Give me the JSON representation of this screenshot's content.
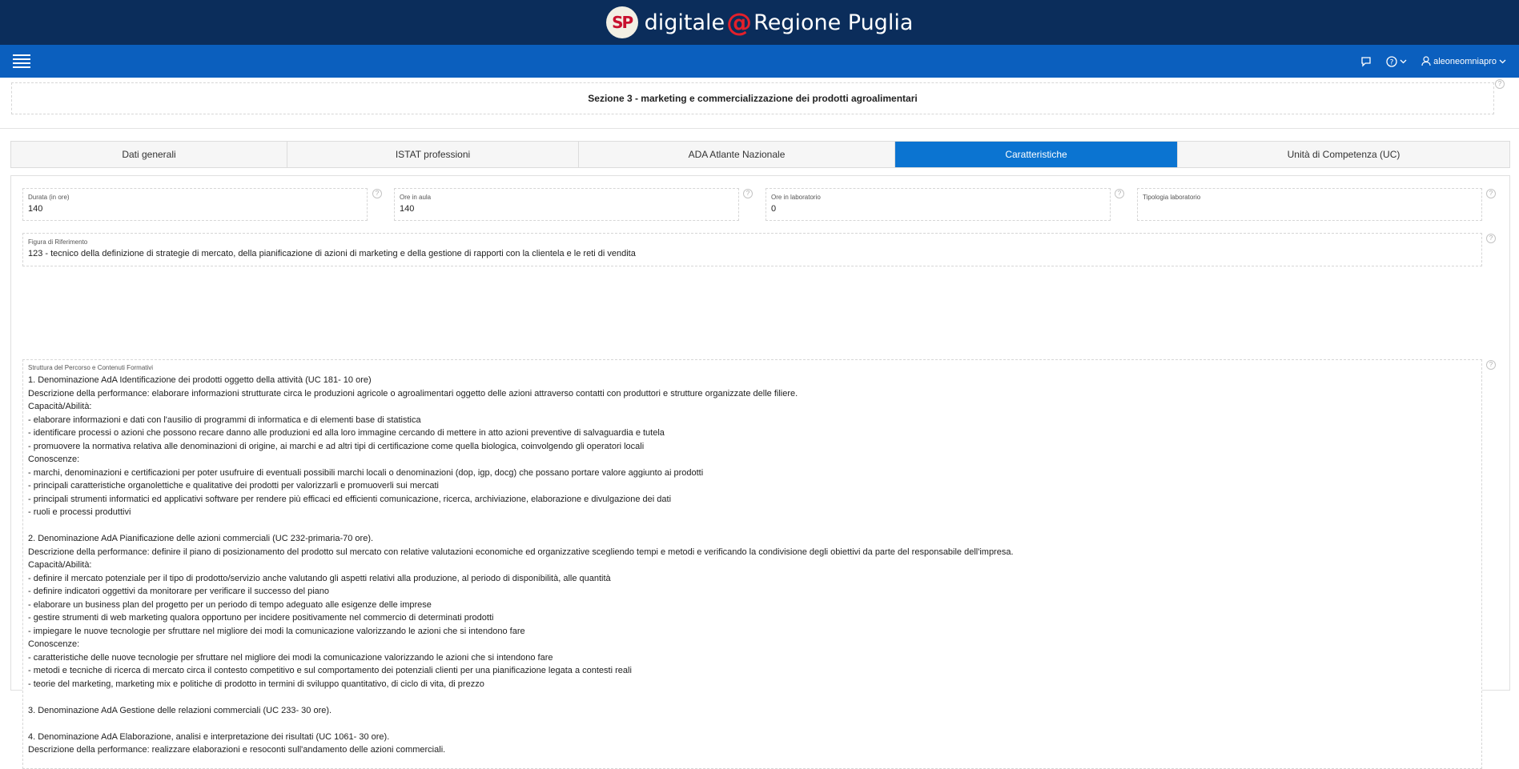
{
  "app": {
    "brand_prefix": "digitale",
    "brand_at": "@",
    "brand_suffix": "Regione Puglia",
    "logo_text": "SP"
  },
  "nav": {
    "user": "aleoneomniapro"
  },
  "section": {
    "title": "Sezione 3 - marketing e commercializzazione dei prodotti agroalimentari"
  },
  "tabs": [
    {
      "label": "Dati generali",
      "active": false
    },
    {
      "label": "ISTAT professioni",
      "active": false
    },
    {
      "label": "ADA Atlante Nazionale",
      "active": false
    },
    {
      "label": "Caratteristiche",
      "active": true
    },
    {
      "label": "Unità di Competenza (UC)",
      "active": false
    }
  ],
  "fields": {
    "durata": {
      "label": "Durata (in ore)",
      "value": "140"
    },
    "ore_aula": {
      "label": "Ore in aula",
      "value": "140"
    },
    "ore_laboratorio": {
      "label": "Ore in laboratorio",
      "value": "0"
    },
    "tipologia_laboratorio": {
      "label": "Tipologia laboratorio",
      "value": ""
    },
    "figura": {
      "label": "Figura di Riferimento",
      "value": "123 - tecnico della definizione di strategie di mercato, della pianificazione di azioni di marketing e della gestione di rapporti con la clientela e le reti di vendita"
    },
    "struttura": {
      "label": "Struttura del Percorso e Contenuti Formativi",
      "value": "1. Denominazione AdA Identificazione dei prodotti oggetto della attività (UC 181- 10 ore)\nDescrizione della performance: elaborare informazioni strutturate circa le produzioni agricole o agroalimentari oggetto delle azioni attraverso contatti con produttori e strutture organizzate delle filiere.\nCapacità/Abilità:\n- elaborare informazioni e dati con l'ausilio di programmi di informatica e di elementi base di statistica\n- identificare processi o azioni che possono recare danno alle produzioni ed alla loro immagine cercando di mettere in atto azioni preventive di salvaguardia e tutela\n- promuovere la normativa relativa alle denominazioni di origine, ai marchi e ad altri tipi di certificazione come quella biologica, coinvolgendo gli operatori locali\nConoscenze:\n- marchi, denominazioni e certificazioni per poter usufruire di eventuali possibili marchi locali o denominazioni (dop, igp, docg) che possano portare valore aggiunto ai prodotti\n- principali caratteristiche organolettiche e qualitative dei prodotti per valorizzarli e promuoverli sui mercati\n- principali strumenti informatici ed applicativi software per rendere più efficaci ed efficienti comunicazione, ricerca, archiviazione, elaborazione e divulgazione dei dati\n- ruoli e processi produttivi\n\n2. Denominazione AdA Pianificazione delle azioni commerciali (UC 232-primaria-70 ore).\nDescrizione della performance: definire il piano di posizionamento del prodotto sul mercato con relative valutazioni economiche ed organizzative scegliendo tempi e metodi e verificando la condivisione degli obiettivi da parte del responsabile dell'impresa.\nCapacità/Abilità:\n- definire il mercato potenziale per il tipo di prodotto/servizio anche valutando gli aspetti relativi alla produzione, al periodo di disponibilità, alle quantità\n- definire indicatori oggettivi da monitorare per verificare il successo del piano\n- elaborare un business plan del progetto per un periodo di tempo adeguato alle esigenze delle imprese\n- gestire strumenti di web marketing qualora opportuno per incidere positivamente nel commercio di determinati prodotti\n- impiegare le nuove tecnologie per sfruttare nel migliore dei modi la comunicazione valorizzando le azioni che si intendono fare\nConoscenze:\n- caratteristiche delle nuove tecnologie per sfruttare nel migliore dei modi la comunicazione valorizzando le azioni che si intendono fare\n- metodi e tecniche di ricerca di mercato circa il contesto competitivo e sul comportamento dei potenziali clienti per una pianificazione legata a contesti reali\n- teorie del marketing, marketing mix e politiche di prodotto in termini di sviluppo quantitativo, di ciclo di vita, di prezzo\n\n3. Denominazione AdA Gestione delle relazioni commerciali (UC 233- 30 ore).\n\n4. Denominazione AdA Elaborazione, analisi e interpretazione dei risultati (UC 1061- 30 ore).\nDescrizione della performance: realizzare elaborazioni e resoconti sull'andamento delle azioni commerciali."
    }
  },
  "help_symbol": "?",
  "colors": {
    "banner": "#0b2d5b",
    "nav": "#0b5fbe",
    "active_tab": "#0b74d1",
    "brand_at": "#e3202b"
  }
}
